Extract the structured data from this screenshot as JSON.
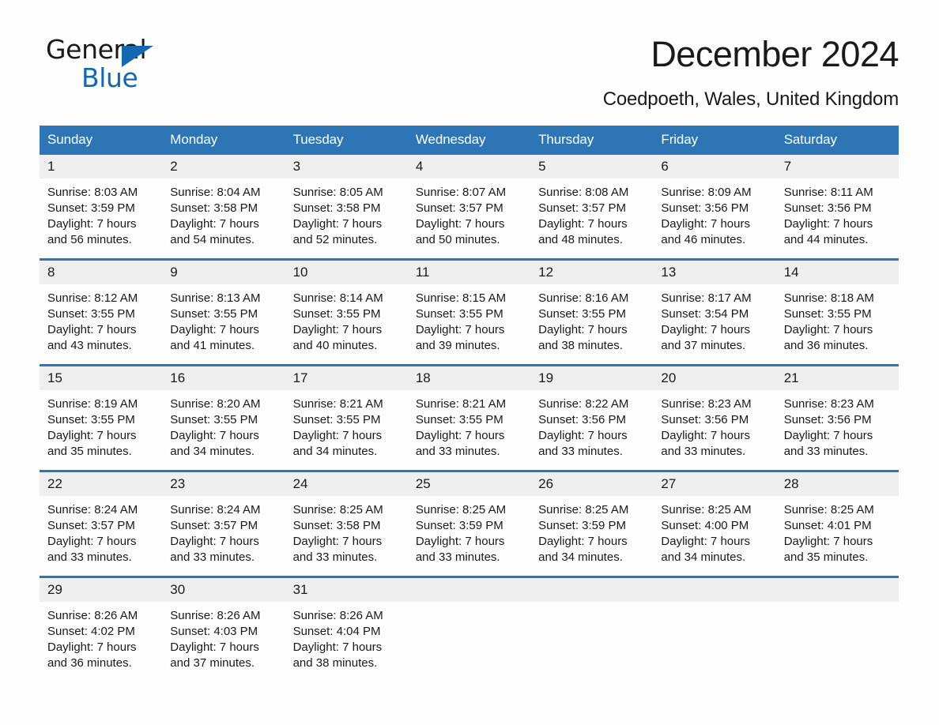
{
  "logo": {
    "primary_text": "General",
    "secondary_text": "Blue",
    "triangle_icon": "triangle-icon",
    "primary_color": "#1a1a1a",
    "accent_color": "#1368b0"
  },
  "header": {
    "title": "December 2024",
    "location": "Coedpoeth, Wales, United Kingdom"
  },
  "theme": {
    "header_blue": "#2e75b6",
    "daynum_band": "#efefef",
    "text": "#1a1a1a"
  },
  "weekday_headers": [
    "Sunday",
    "Monday",
    "Tuesday",
    "Wednesday",
    "Thursday",
    "Friday",
    "Saturday"
  ],
  "weeks": [
    [
      {
        "day": "1",
        "sunrise": "Sunrise: 8:03 AM",
        "sunset": "Sunset: 3:59 PM",
        "daylight_1": "Daylight: 7 hours",
        "daylight_2": "and 56 minutes."
      },
      {
        "day": "2",
        "sunrise": "Sunrise: 8:04 AM",
        "sunset": "Sunset: 3:58 PM",
        "daylight_1": "Daylight: 7 hours",
        "daylight_2": "and 54 minutes."
      },
      {
        "day": "3",
        "sunrise": "Sunrise: 8:05 AM",
        "sunset": "Sunset: 3:58 PM",
        "daylight_1": "Daylight: 7 hours",
        "daylight_2": "and 52 minutes."
      },
      {
        "day": "4",
        "sunrise": "Sunrise: 8:07 AM",
        "sunset": "Sunset: 3:57 PM",
        "daylight_1": "Daylight: 7 hours",
        "daylight_2": "and 50 minutes."
      },
      {
        "day": "5",
        "sunrise": "Sunrise: 8:08 AM",
        "sunset": "Sunset: 3:57 PM",
        "daylight_1": "Daylight: 7 hours",
        "daylight_2": "and 48 minutes."
      },
      {
        "day": "6",
        "sunrise": "Sunrise: 8:09 AM",
        "sunset": "Sunset: 3:56 PM",
        "daylight_1": "Daylight: 7 hours",
        "daylight_2": "and 46 minutes."
      },
      {
        "day": "7",
        "sunrise": "Sunrise: 8:11 AM",
        "sunset": "Sunset: 3:56 PM",
        "daylight_1": "Daylight: 7 hours",
        "daylight_2": "and 44 minutes."
      }
    ],
    [
      {
        "day": "8",
        "sunrise": "Sunrise: 8:12 AM",
        "sunset": "Sunset: 3:55 PM",
        "daylight_1": "Daylight: 7 hours",
        "daylight_2": "and 43 minutes."
      },
      {
        "day": "9",
        "sunrise": "Sunrise: 8:13 AM",
        "sunset": "Sunset: 3:55 PM",
        "daylight_1": "Daylight: 7 hours",
        "daylight_2": "and 41 minutes."
      },
      {
        "day": "10",
        "sunrise": "Sunrise: 8:14 AM",
        "sunset": "Sunset: 3:55 PM",
        "daylight_1": "Daylight: 7 hours",
        "daylight_2": "and 40 minutes."
      },
      {
        "day": "11",
        "sunrise": "Sunrise: 8:15 AM",
        "sunset": "Sunset: 3:55 PM",
        "daylight_1": "Daylight: 7 hours",
        "daylight_2": "and 39 minutes."
      },
      {
        "day": "12",
        "sunrise": "Sunrise: 8:16 AM",
        "sunset": "Sunset: 3:55 PM",
        "daylight_1": "Daylight: 7 hours",
        "daylight_2": "and 38 minutes."
      },
      {
        "day": "13",
        "sunrise": "Sunrise: 8:17 AM",
        "sunset": "Sunset: 3:54 PM",
        "daylight_1": "Daylight: 7 hours",
        "daylight_2": "and 37 minutes."
      },
      {
        "day": "14",
        "sunrise": "Sunrise: 8:18 AM",
        "sunset": "Sunset: 3:55 PM",
        "daylight_1": "Daylight: 7 hours",
        "daylight_2": "and 36 minutes."
      }
    ],
    [
      {
        "day": "15",
        "sunrise": "Sunrise: 8:19 AM",
        "sunset": "Sunset: 3:55 PM",
        "daylight_1": "Daylight: 7 hours",
        "daylight_2": "and 35 minutes."
      },
      {
        "day": "16",
        "sunrise": "Sunrise: 8:20 AM",
        "sunset": "Sunset: 3:55 PM",
        "daylight_1": "Daylight: 7 hours",
        "daylight_2": "and 34 minutes."
      },
      {
        "day": "17",
        "sunrise": "Sunrise: 8:21 AM",
        "sunset": "Sunset: 3:55 PM",
        "daylight_1": "Daylight: 7 hours",
        "daylight_2": "and 34 minutes."
      },
      {
        "day": "18",
        "sunrise": "Sunrise: 8:21 AM",
        "sunset": "Sunset: 3:55 PM",
        "daylight_1": "Daylight: 7 hours",
        "daylight_2": "and 33 minutes."
      },
      {
        "day": "19",
        "sunrise": "Sunrise: 8:22 AM",
        "sunset": "Sunset: 3:56 PM",
        "daylight_1": "Daylight: 7 hours",
        "daylight_2": "and 33 minutes."
      },
      {
        "day": "20",
        "sunrise": "Sunrise: 8:23 AM",
        "sunset": "Sunset: 3:56 PM",
        "daylight_1": "Daylight: 7 hours",
        "daylight_2": "and 33 minutes."
      },
      {
        "day": "21",
        "sunrise": "Sunrise: 8:23 AM",
        "sunset": "Sunset: 3:56 PM",
        "daylight_1": "Daylight: 7 hours",
        "daylight_2": "and 33 minutes."
      }
    ],
    [
      {
        "day": "22",
        "sunrise": "Sunrise: 8:24 AM",
        "sunset": "Sunset: 3:57 PM",
        "daylight_1": "Daylight: 7 hours",
        "daylight_2": "and 33 minutes."
      },
      {
        "day": "23",
        "sunrise": "Sunrise: 8:24 AM",
        "sunset": "Sunset: 3:57 PM",
        "daylight_1": "Daylight: 7 hours",
        "daylight_2": "and 33 minutes."
      },
      {
        "day": "24",
        "sunrise": "Sunrise: 8:25 AM",
        "sunset": "Sunset: 3:58 PM",
        "daylight_1": "Daylight: 7 hours",
        "daylight_2": "and 33 minutes."
      },
      {
        "day": "25",
        "sunrise": "Sunrise: 8:25 AM",
        "sunset": "Sunset: 3:59 PM",
        "daylight_1": "Daylight: 7 hours",
        "daylight_2": "and 33 minutes."
      },
      {
        "day": "26",
        "sunrise": "Sunrise: 8:25 AM",
        "sunset": "Sunset: 3:59 PM",
        "daylight_1": "Daylight: 7 hours",
        "daylight_2": "and 34 minutes."
      },
      {
        "day": "27",
        "sunrise": "Sunrise: 8:25 AM",
        "sunset": "Sunset: 4:00 PM",
        "daylight_1": "Daylight: 7 hours",
        "daylight_2": "and 34 minutes."
      },
      {
        "day": "28",
        "sunrise": "Sunrise: 8:25 AM",
        "sunset": "Sunset: 4:01 PM",
        "daylight_1": "Daylight: 7 hours",
        "daylight_2": "and 35 minutes."
      }
    ],
    [
      {
        "day": "29",
        "sunrise": "Sunrise: 8:26 AM",
        "sunset": "Sunset: 4:02 PM",
        "daylight_1": "Daylight: 7 hours",
        "daylight_2": "and 36 minutes."
      },
      {
        "day": "30",
        "sunrise": "Sunrise: 8:26 AM",
        "sunset": "Sunset: 4:03 PM",
        "daylight_1": "Daylight: 7 hours",
        "daylight_2": "and 37 minutes."
      },
      {
        "day": "31",
        "sunrise": "Sunrise: 8:26 AM",
        "sunset": "Sunset: 4:04 PM",
        "daylight_1": "Daylight: 7 hours",
        "daylight_2": "and 38 minutes."
      },
      {
        "day": "",
        "sunrise": "",
        "sunset": "",
        "daylight_1": "",
        "daylight_2": ""
      },
      {
        "day": "",
        "sunrise": "",
        "sunset": "",
        "daylight_1": "",
        "daylight_2": ""
      },
      {
        "day": "",
        "sunrise": "",
        "sunset": "",
        "daylight_1": "",
        "daylight_2": ""
      },
      {
        "day": "",
        "sunrise": "",
        "sunset": "",
        "daylight_1": "",
        "daylight_2": ""
      }
    ]
  ]
}
